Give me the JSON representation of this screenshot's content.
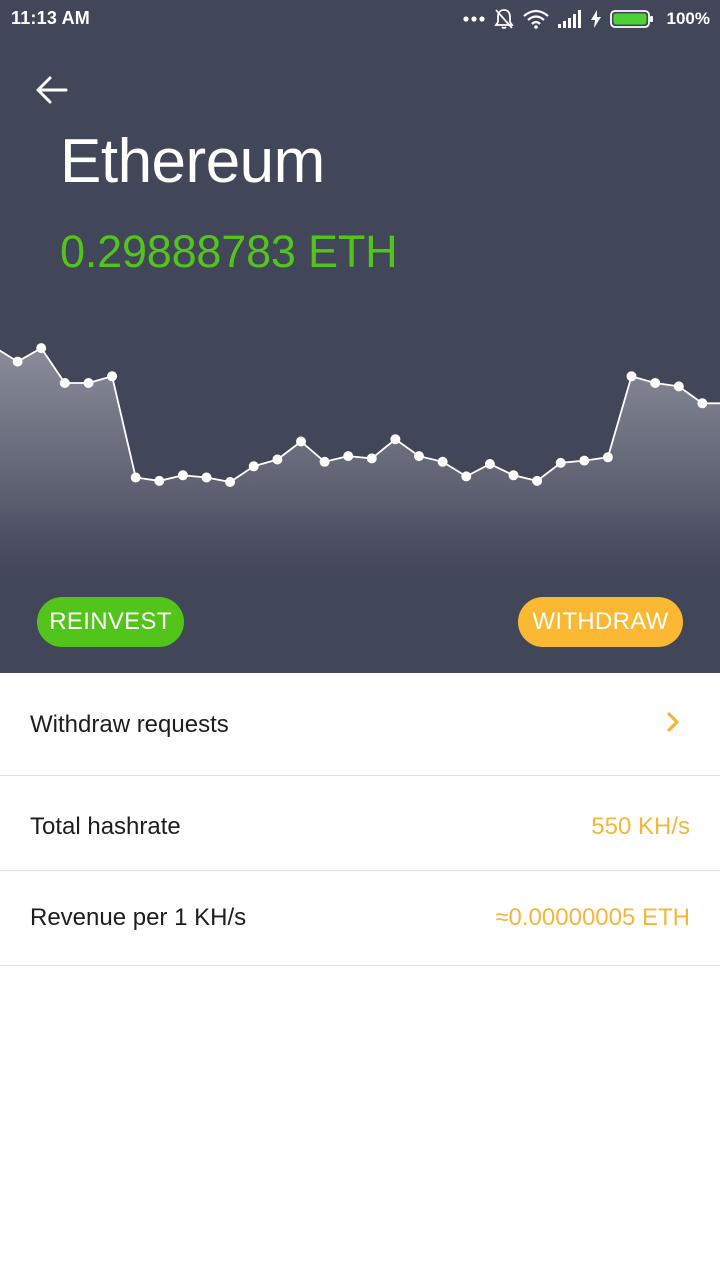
{
  "status_bar": {
    "time": "11:13 AM",
    "battery": "100%",
    "icons": [
      "more-dots-icon",
      "mute-bell-icon",
      "wifi-icon",
      "signal-icon",
      "charging-icon",
      "battery-icon"
    ]
  },
  "header": {
    "back_icon": "arrow-left-icon",
    "title": "Ethereum",
    "balance": "0.29888783 ETH"
  },
  "chart_data": {
    "type": "area",
    "title": "",
    "xlabel": "",
    "ylabel": "",
    "values": [
      0.76,
      0.63,
      0.75,
      0.44,
      0.44,
      0.5,
      -0.4,
      -0.43,
      -0.38,
      -0.4,
      -0.44,
      -0.3,
      -0.24,
      -0.08,
      -0.26,
      -0.21,
      -0.23,
      -0.06,
      -0.21,
      -0.26,
      -0.39,
      -0.28,
      -0.38,
      -0.43,
      -0.27,
      -0.25,
      -0.22,
      0.5,
      0.44,
      0.41,
      0.26,
      0.26
    ],
    "ylim": [
      -1,
      1
    ],
    "grid": false,
    "legend": "none",
    "line_color": "#ffffff",
    "fill_color": "#7b7f8e"
  },
  "actions": {
    "reinvest_label": "REINVEST",
    "withdraw_label": "WITHDRAW"
  },
  "list": {
    "withdraw_requests_label": "Withdraw requests",
    "total_hashrate_label": "Total hashrate",
    "total_hashrate_value": "550 KH/s",
    "revenue_label": "Revenue per 1 KH/s",
    "revenue_value": "≈0.00000005 ETH"
  },
  "colors": {
    "header_bg": "#424659",
    "green": "#52c41a",
    "orange": "#fbb832",
    "value_text": "#f5b73a"
  }
}
